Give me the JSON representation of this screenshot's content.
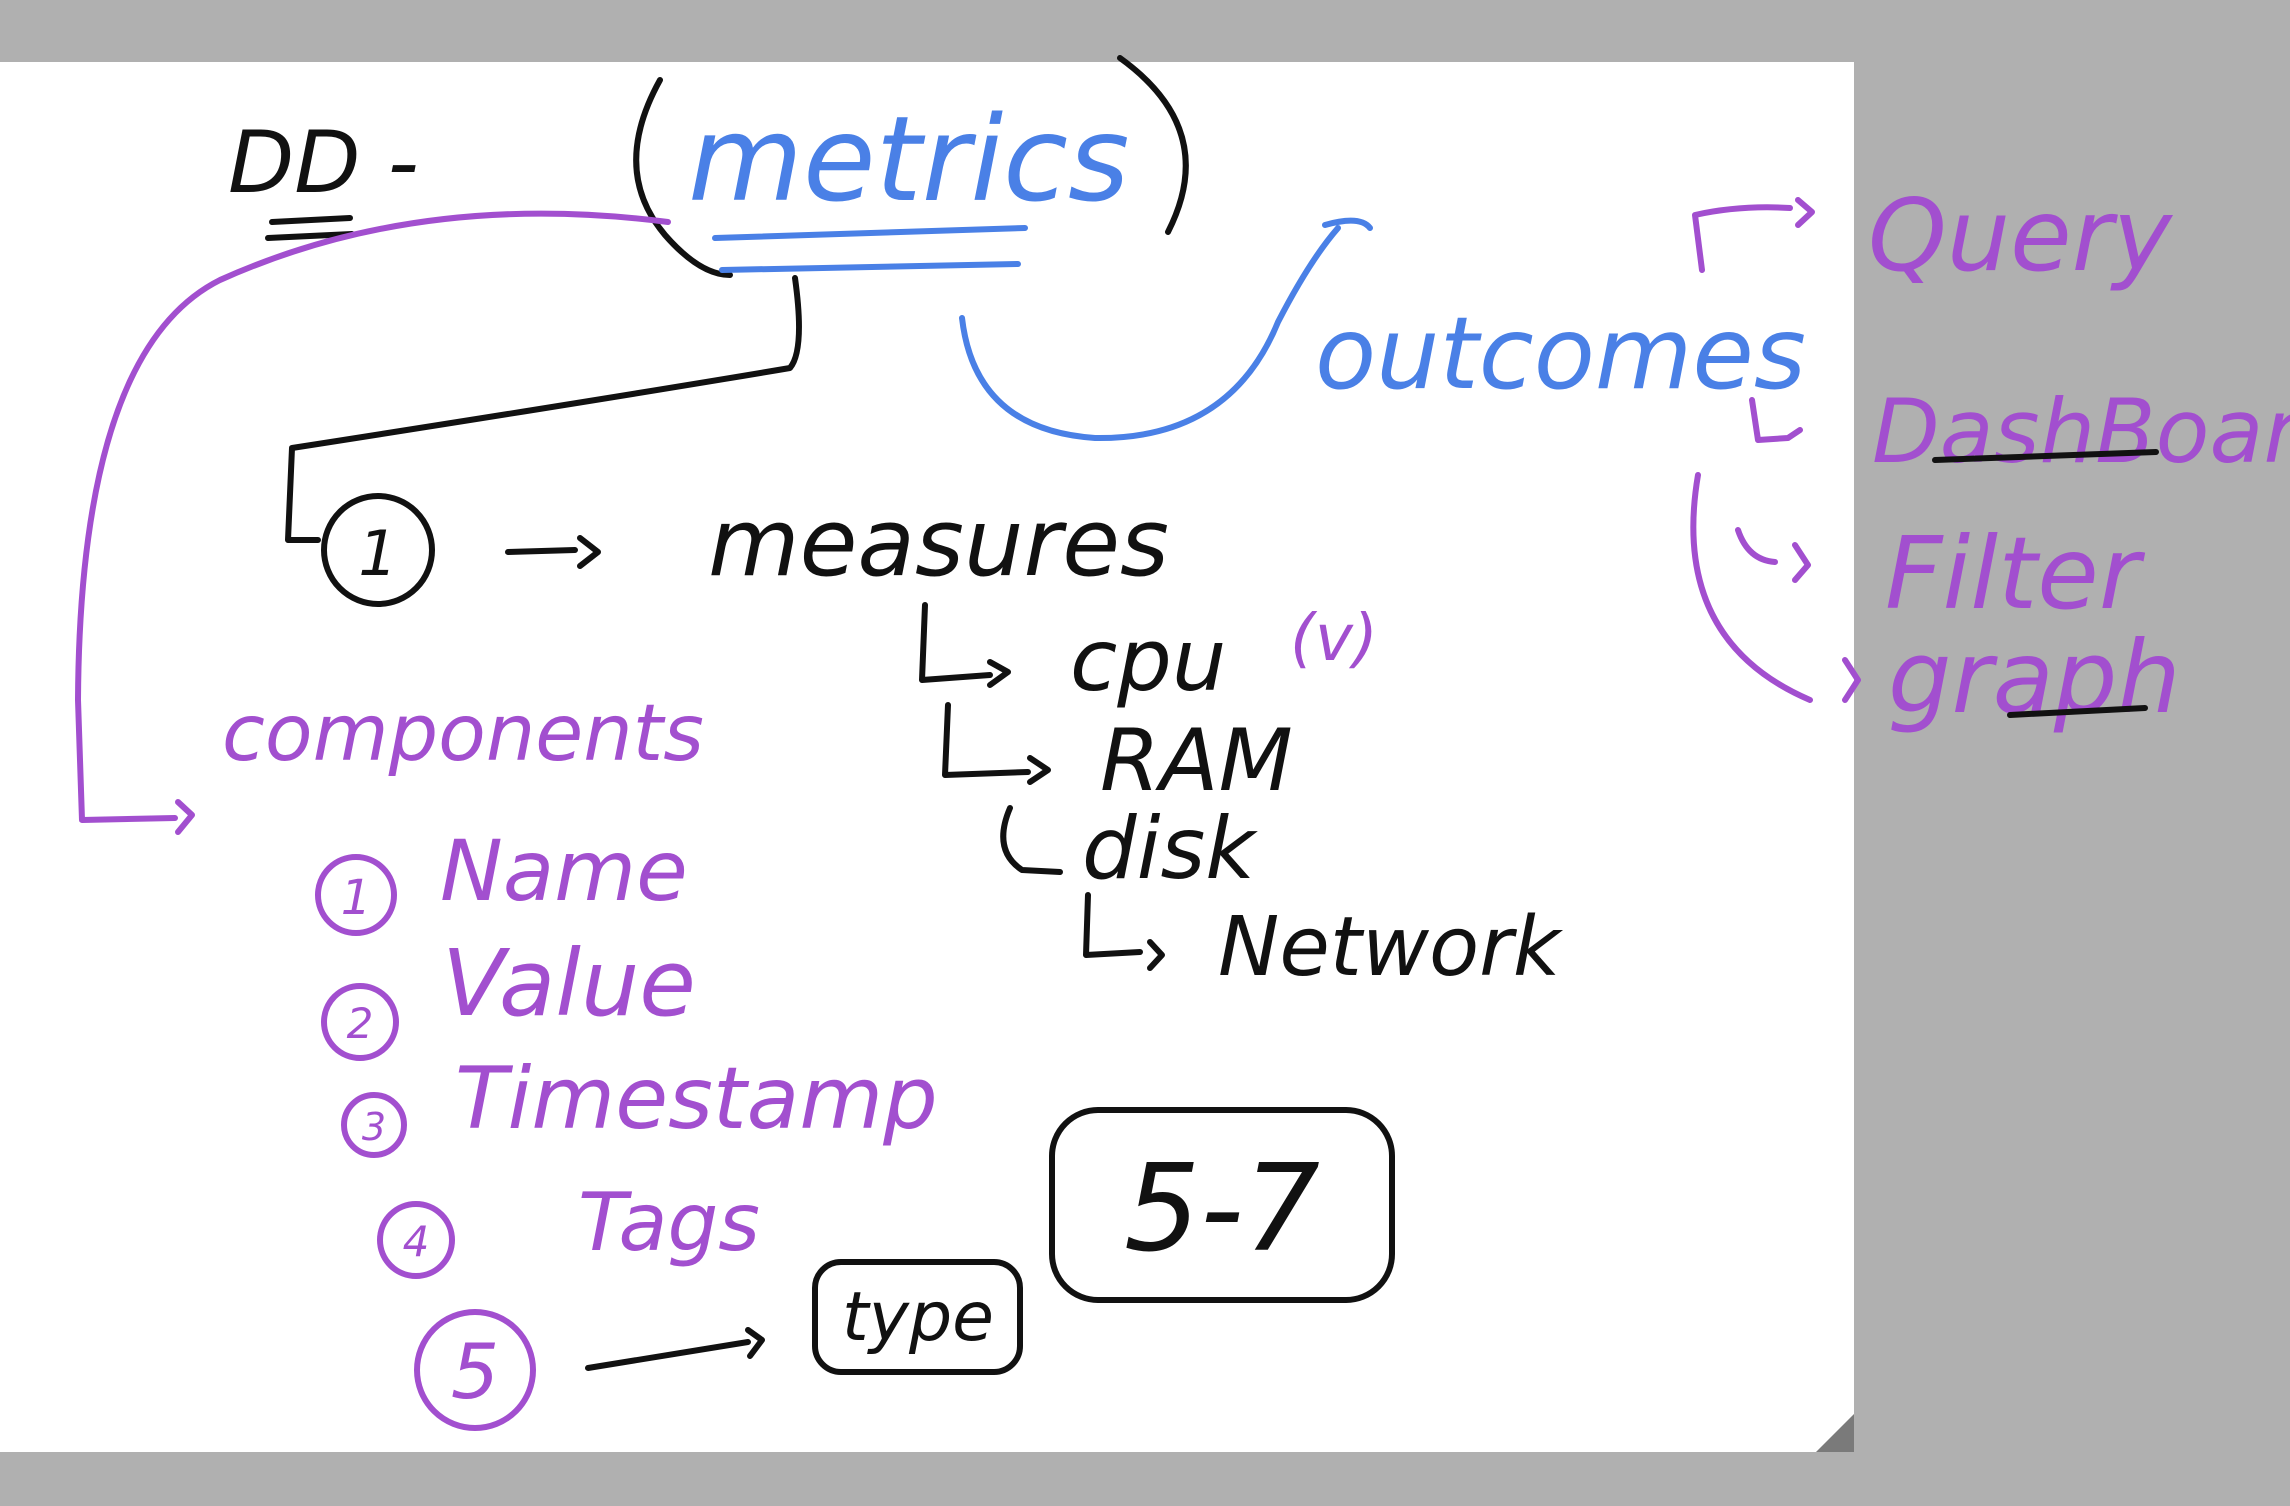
{
  "colors": {
    "ink_black": "#111111",
    "ink_purple": "#a24fcf",
    "ink_blue": "#4a80e6",
    "page": "#ffffff",
    "background": "#b0b0b0"
  },
  "title_abbrev": "DD -",
  "central": "metrics",
  "outcomes": {
    "label": "outcomes",
    "items": [
      "Query",
      "DashBoard",
      "Filter",
      "graph"
    ]
  },
  "measures": {
    "number": "1",
    "label": "measures",
    "items": [
      "cpu",
      "RAM",
      "disk",
      "Network"
    ],
    "cpu_note": "(v)"
  },
  "components": {
    "label": "components",
    "items": [
      {
        "number": "1",
        "label": "Name"
      },
      {
        "number": "2",
        "label": "Value"
      },
      {
        "number": "3",
        "label": "Timestamp"
      },
      {
        "number": "4",
        "label": "Tags"
      },
      {
        "number": "5",
        "label": ""
      }
    ]
  },
  "type_box": "type",
  "range_box": "5-7"
}
